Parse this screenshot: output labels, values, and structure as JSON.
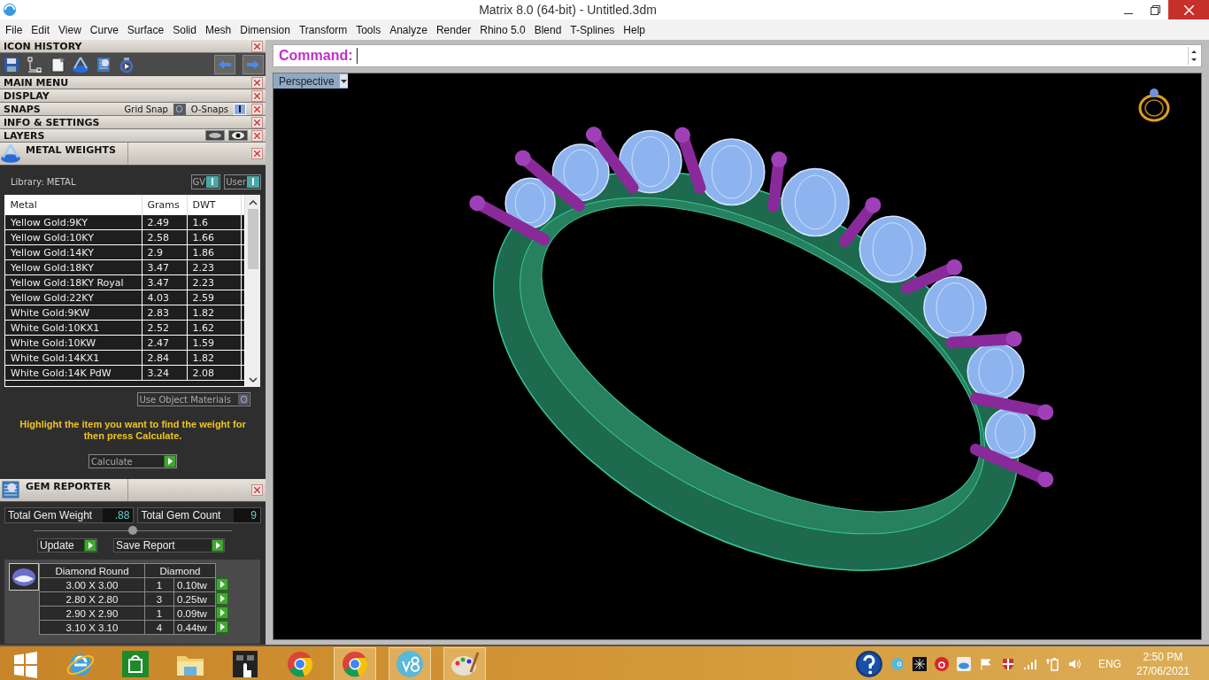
{
  "window": {
    "title": "Matrix 8.0 (64-bit) - Untitled.3dm"
  },
  "menu": [
    "File",
    "Edit",
    "View",
    "Curve",
    "Surface",
    "Solid",
    "Mesh",
    "Dimension",
    "Transform",
    "Tools",
    "Analyze",
    "Render",
    "Rhino 5.0",
    "Blend",
    "T-Splines",
    "Help"
  ],
  "sidebar": {
    "sections": [
      {
        "title": "ICON HISTORY",
        "kind": "history"
      },
      {
        "title": "MAIN MENU",
        "kind": "plain"
      },
      {
        "title": "DISPLAY",
        "kind": "plain"
      },
      {
        "title": "SNAPS",
        "kind": "snaps",
        "toggles": [
          {
            "label": "Grid Snap",
            "on": false
          },
          {
            "label": "O-Snaps",
            "on": true
          }
        ]
      },
      {
        "title": "INFO & SETTINGS",
        "kind": "plain"
      },
      {
        "title": "LAYERS",
        "kind": "layers"
      }
    ],
    "metal_weights": {
      "title": "METAL WEIGHTS",
      "library": "Library: METAL",
      "toggles": [
        {
          "label": "GV",
          "on": true
        },
        {
          "label": "User",
          "on": true
        }
      ],
      "columns": [
        "Metal",
        "Grams",
        "DWT"
      ],
      "rows": [
        [
          "Yellow Gold:9KY",
          "2.49",
          "1.6"
        ],
        [
          "Yellow Gold:10KY",
          "2.58",
          "1.66"
        ],
        [
          "Yellow Gold:14KY",
          "2.9",
          "1.86"
        ],
        [
          "Yellow Gold:18KY",
          "3.47",
          "2.23"
        ],
        [
          "Yellow Gold:18KY Royal",
          "3.47",
          "2.23"
        ],
        [
          "Yellow Gold:22KY",
          "4.03",
          "2.59"
        ],
        [
          "White Gold:9KW",
          "2.83",
          "1.82"
        ],
        [
          "White Gold:10KX1",
          "2.52",
          "1.62"
        ],
        [
          "White Gold:10KW",
          "2.47",
          "1.59"
        ],
        [
          "White Gold:14KX1",
          "2.84",
          "1.82"
        ],
        [
          "White Gold:14K PdW",
          "3.24",
          "2.08"
        ]
      ],
      "use_object_materials": {
        "label": "Use Object Materials",
        "checked": false
      },
      "hint": "Highlight the item you want to find the weight for then press Calculate.",
      "calculate": "Calculate"
    },
    "gem_reporter": {
      "title": "GEM REPORTER",
      "totals": [
        {
          "label": "Total Gem Weight",
          "value": ".88"
        },
        {
          "label": "Total Gem Count",
          "value": "9"
        }
      ],
      "buttons": [
        "Update",
        "Save Report"
      ],
      "columns": [
        "Diamond Round",
        "Diamond"
      ],
      "rows": [
        {
          "size": "3.00 X 3.00",
          "count": "1",
          "weight": "0.10tw"
        },
        {
          "size": "2.80 X 2.80",
          "count": "3",
          "weight": "0.25tw"
        },
        {
          "size": "2.90 X 2.90",
          "count": "1",
          "weight": "0.09tw"
        },
        {
          "size": "3.10 X 3.10",
          "count": "4",
          "weight": "0.44tw"
        }
      ]
    }
  },
  "command": {
    "label": "Command:"
  },
  "viewport": {
    "name": "Perspective"
  },
  "taskbar": {
    "apps": [
      {
        "kind": "start",
        "running": false
      },
      {
        "kind": "ie",
        "running": false
      },
      {
        "kind": "store",
        "running": false
      },
      {
        "kind": "explorer",
        "running": false
      },
      {
        "kind": "touch",
        "running": false
      },
      {
        "kind": "chrome",
        "running": false
      },
      {
        "kind": "chrome",
        "running": true
      },
      {
        "kind": "v8",
        "running": true
      },
      {
        "kind": "paint",
        "running": true
      }
    ],
    "language": "ENG",
    "time": "2:50 PM",
    "date": "27/06/2021"
  }
}
